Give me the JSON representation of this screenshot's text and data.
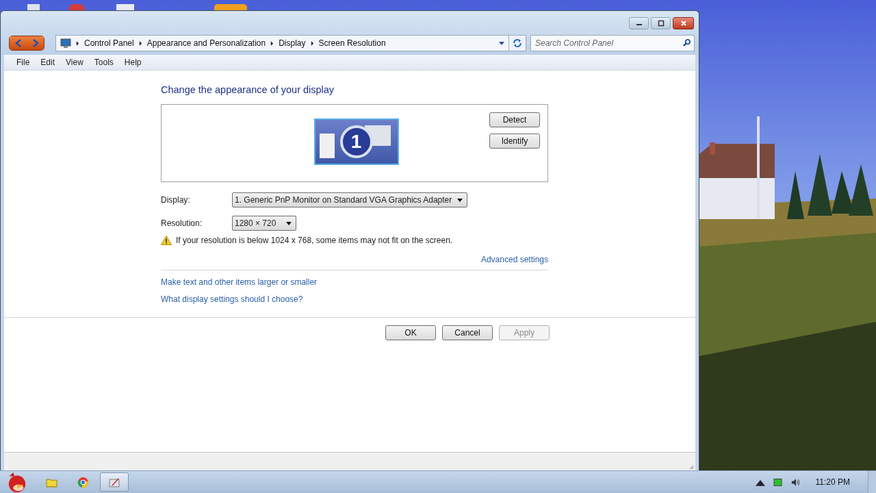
{
  "window": {
    "breadcrumb": [
      "Control Panel",
      "Appearance and Personalization",
      "Display",
      "Screen Resolution"
    ],
    "search": {
      "placeholder": "Search Control Panel"
    },
    "menu": [
      "File",
      "Edit",
      "View",
      "Tools",
      "Help"
    ],
    "heading": "Change the appearance of your display",
    "monitor": {
      "number": "1",
      "selected": true
    },
    "side_buttons": [
      "Detect",
      "Identify"
    ],
    "display": {
      "label": "Display:",
      "value": "1. Generic PnP Monitor on Standard VGA Graphics Adapter"
    },
    "resolution": {
      "label": "Resolution:",
      "value": "1280 × 720"
    },
    "warning": "If your resolution is below 1024 x 768, some items may not fit on the screen.",
    "advanced_link": "Advanced settings",
    "links": [
      "Make text and other items larger or smaller",
      "What display settings should I choose?"
    ],
    "buttons": [
      {
        "label": "OK",
        "disabled": false
      },
      {
        "label": "Cancel",
        "disabled": false
      },
      {
        "label": "Apply",
        "disabled": true
      }
    ]
  },
  "taskbar": {
    "apps": [
      {
        "kind": "folder",
        "selected": false
      },
      {
        "kind": "browser",
        "selected": false
      },
      {
        "kind": "paint",
        "selected": true
      }
    ],
    "clock": "11:20 PM"
  }
}
